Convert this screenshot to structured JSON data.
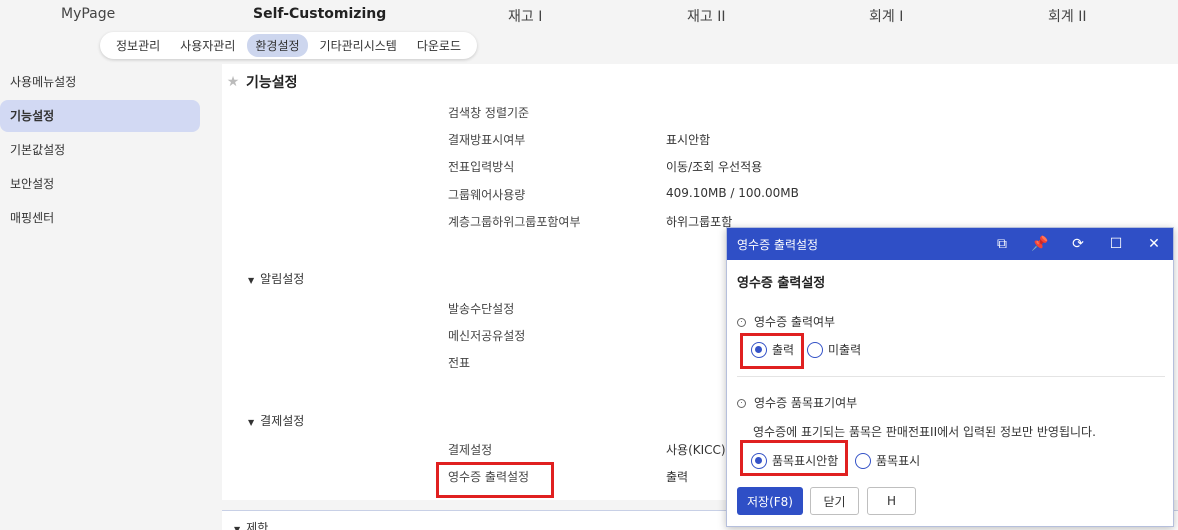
{
  "topnav": {
    "items": [
      "MyPage",
      "Self-Customizing",
      "재고 I",
      "재고 II",
      "회계 I",
      "회계 II"
    ]
  },
  "subtabs": [
    "정보관리",
    "사용자관리",
    "환경설정",
    "기타관리시스템",
    "다운로드"
  ],
  "sidebar": {
    "items": [
      "사용메뉴설정",
      "기능설정",
      "기본값설정",
      "보안설정",
      "매핑센터"
    ]
  },
  "page": {
    "title": "기능설정"
  },
  "rows": [
    {
      "label": "검색창 정렬기준",
      "value": ""
    },
    {
      "label": "결재방표시여부",
      "value": "표시안함"
    },
    {
      "label": "전표입력방식",
      "value": "이동/조회 우선적용"
    },
    {
      "label": "그룹웨어사용량",
      "value": "409.10MB / 100.00MB"
    },
    {
      "label": "계층그룹하위그룹포함여부",
      "value": "하위그룹포함"
    }
  ],
  "sections": {
    "alarm": "알림설정",
    "payment": "결제설정",
    "limit": "제한"
  },
  "alarm_rows": [
    "발송수단설정",
    "메신저공유설정",
    "전표"
  ],
  "payment_rows": [
    {
      "label": "결제설정",
      "value": "사용(KICC)"
    },
    {
      "label": "영수증 출력설정",
      "value": "출력"
    }
  ],
  "dialog": {
    "header_title": "영수증 출력설정",
    "title": "영수증 출력설정",
    "group1": {
      "label": "영수증 출력여부",
      "options": [
        "출력",
        "미출력"
      ]
    },
    "group2": {
      "label": "영수증 품목표기여부",
      "note": "영수증에 표기되는 품목은 판매전표II에서 입력된 정보만 반영됩니다.",
      "options": [
        "품목표시안함",
        "품목표시"
      ]
    },
    "buttons": {
      "save": "저장(F8)",
      "close": "닫기",
      "h": "H"
    }
  }
}
